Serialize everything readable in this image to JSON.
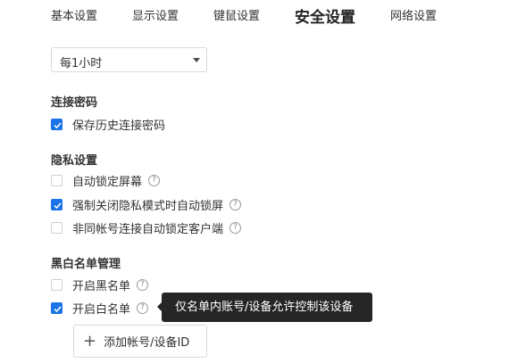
{
  "tabs": [
    {
      "label": "基本设置"
    },
    {
      "label": "显示设置"
    },
    {
      "label": "键鼠设置"
    },
    {
      "label": "安全设置"
    },
    {
      "label": "网络设置"
    }
  ],
  "active_tab": "安全设置",
  "interval_select": {
    "value": "每1小时"
  },
  "connection_password": {
    "title": "连接密码",
    "options": [
      {
        "label": "保存历史连接密码",
        "checked": true
      }
    ]
  },
  "privacy": {
    "title": "隐私设置",
    "options": [
      {
        "label": "自动锁定屏幕",
        "checked": false,
        "help": "?"
      },
      {
        "label": "强制关闭隐私模式时自动锁屏",
        "checked": true,
        "help": "?"
      },
      {
        "label": "非同帐号连接自动锁定客户端",
        "checked": false,
        "help": "?"
      }
    ]
  },
  "whitelist": {
    "title": "黑白名单管理",
    "options": [
      {
        "label": "开启黑名单",
        "checked": false,
        "help": "?"
      },
      {
        "label": "开启白名单",
        "checked": true,
        "help": "?"
      }
    ],
    "tooltip": "仅名单内账号/设备允许控制该设备",
    "add_button": {
      "icon": "plus-icon",
      "label": "添加帐号/设备ID"
    }
  },
  "colors": {
    "accent": "#1a73e8",
    "tooltip_bg": "#262626"
  }
}
